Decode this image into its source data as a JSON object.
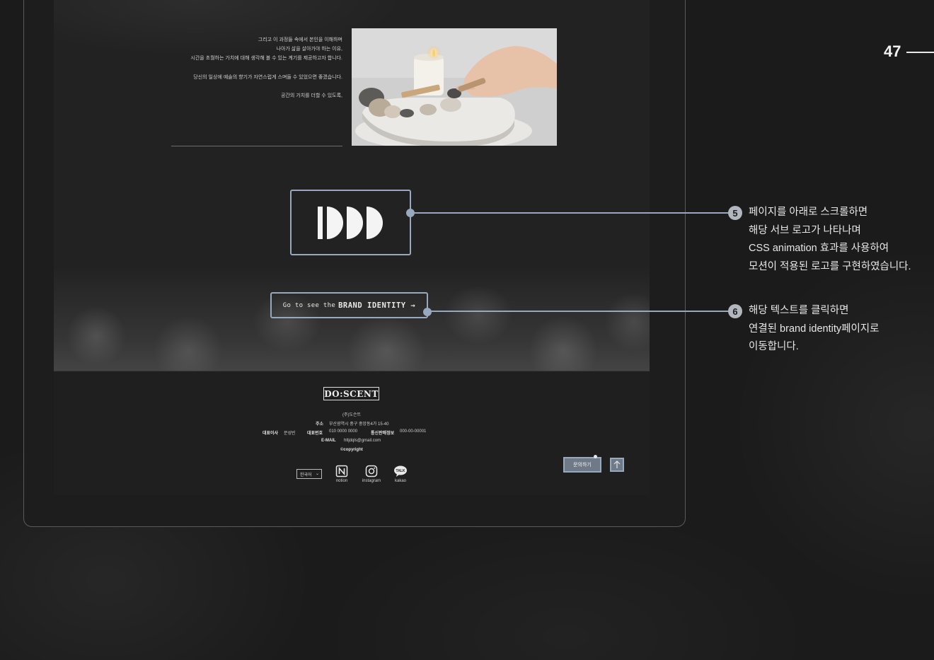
{
  "page_number": "47",
  "story": {
    "lines": [
      "그리고 이 과정들 속에서 본인을 이해하며",
      "나아가 삶을 살아가야 하는 이유,",
      "시간을 초월하는 가치에 대해 생각해 볼 수 있는 계기를 제공하고자 합니다.",
      "당신의 일상에 예술의 향기가 자연스럽게 스며들 수 있었으면 좋겠습니다.",
      "공간의 가치를 더할 수 있도록,"
    ]
  },
  "brand_link": {
    "prefix": "Go to see the",
    "emphasis": "BRAND IDENTITY →"
  },
  "footer": {
    "logo": "DO:SCENT",
    "company": "(주)도슨트",
    "address_label": "주소",
    "address": "부산광역시 중구 중앙동4가 15-40",
    "ceo_label": "대표이사",
    "ceo": "문성빈",
    "phone_label": "대표번호",
    "phone": "010 0000 0000",
    "ecommerce_label": "통신판매정보",
    "ecommerce": "000-00-00001",
    "email_label": "E-MAIL",
    "email": "hltjdqls@gmail.com",
    "copyright": "©copyright",
    "language": "한국어",
    "social": [
      {
        "label": "notion",
        "icon": "notion-icon"
      },
      {
        "label": "instagram",
        "icon": "instagram-icon"
      },
      {
        "label": "kakao",
        "icon": "kakao-icon"
      }
    ],
    "inquiry_label": "문의하기"
  },
  "annotations": [
    {
      "number": "5",
      "lines": [
        "페이지를 아래로 스크롤하면",
        "해당 서브 로고가 나타나며",
        "CSS animation 효과를 사용하여",
        "모션이 적용된 로고를 구현하였습니다."
      ]
    },
    {
      "number": "6",
      "lines": [
        "해당 텍스트를 클릭하면",
        "연결된 brand identity페이지로",
        "이동합니다."
      ]
    }
  ],
  "colors": {
    "background": "#1b1b1b",
    "accent_outline": "#98a9be",
    "badge": "#b2b7bf"
  }
}
